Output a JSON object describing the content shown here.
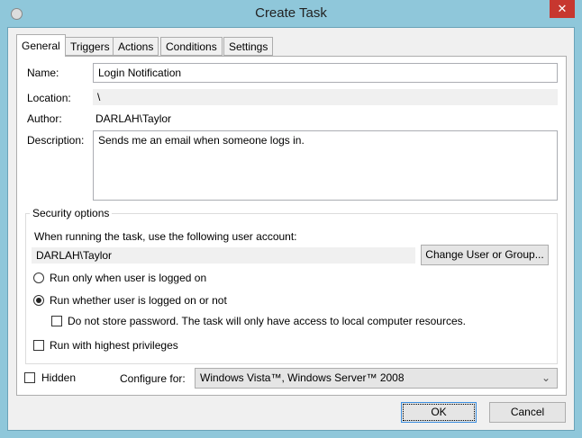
{
  "window": {
    "title": "Create Task",
    "close": "✕"
  },
  "tabs": [
    "General",
    "Triggers",
    "Actions",
    "Conditions",
    "Settings"
  ],
  "general": {
    "name_label": "Name:",
    "name_value": "Login Notification",
    "location_label": "Location:",
    "location_value": "\\",
    "author_label": "Author:",
    "author_value": "DARLAH\\Taylor",
    "description_label": "Description:",
    "description_value": "Sends me an email when someone logs in."
  },
  "security": {
    "legend": "Security options",
    "account_prompt": "When running the task, use the following user account:",
    "account_value": "DARLAH\\Taylor",
    "change_button": "Change User or Group...",
    "radio_logged_on": "Run only when user is logged on",
    "radio_whether": "Run whether user is logged on or not",
    "selected": "Run whether user is logged on or not",
    "no_store_password": "Do not store password.  The task will only have access to local computer resources.",
    "highest_privileges": "Run with highest privileges"
  },
  "footer": {
    "hidden_label": "Hidden",
    "configure_label": "Configure for:",
    "configure_value": "Windows Vista™, Windows Server™ 2008",
    "ok": "OK",
    "cancel": "Cancel"
  }
}
